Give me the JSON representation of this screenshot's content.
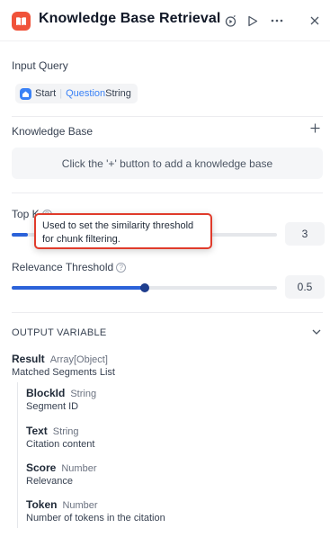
{
  "header": {
    "title": "Knowledge Base Retrieval",
    "icons": [
      "book-icon",
      "run-step-icon",
      "play-icon",
      "more-icon",
      "close-icon"
    ]
  },
  "input_query": {
    "label": "Input Query",
    "chip": {
      "node": "Start",
      "variable": "Question",
      "type": "String"
    }
  },
  "knowledge_base": {
    "label": "Knowledge Base",
    "empty_text": "Click the '+' button to add a knowledge base"
  },
  "top_k": {
    "label": "Top K",
    "value": "3",
    "fill_fraction": 0.0,
    "tooltip": "Used to set the similarity threshold for chunk filtering."
  },
  "relevance_threshold": {
    "label": "Relevance Threshold",
    "value": "0.5",
    "fill_fraction": 0.5
  },
  "output": {
    "title": "OUTPUT VARIABLE",
    "result": {
      "name": "Result",
      "type": "Array[Object]",
      "desc": "Matched Segments List"
    },
    "fields": [
      {
        "name": "BlockId",
        "type": "String",
        "desc": "Segment ID"
      },
      {
        "name": "Text",
        "type": "String",
        "desc": "Citation content"
      },
      {
        "name": "Score",
        "type": "Number",
        "desc": "Relevance"
      },
      {
        "name": "Token",
        "type": "Number",
        "desc": "Number of tokens in the citation"
      }
    ]
  },
  "colors": {
    "brand": "#f0533a",
    "accent": "#2b62d9",
    "tooltip_border": "#e03b2b"
  }
}
